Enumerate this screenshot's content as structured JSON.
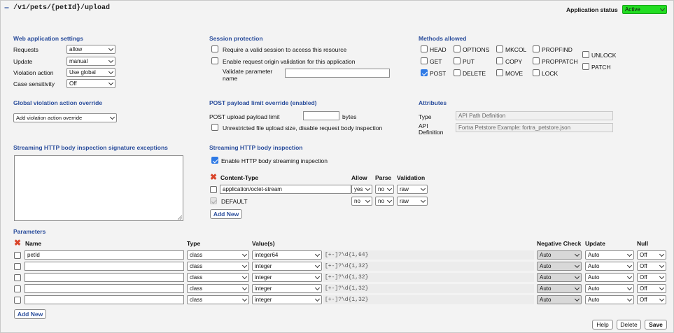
{
  "header": {
    "collapse_glyph": "−",
    "path": "/v1/pets/{petId}/upload",
    "status_label": "Application status",
    "status_value": "Active"
  },
  "web_app": {
    "title": "Web application settings",
    "rows": [
      {
        "label": "Requests",
        "value": "allow"
      },
      {
        "label": "Update",
        "value": "manual"
      },
      {
        "label": "Violation action",
        "value": "Use global"
      },
      {
        "label": "Case sensitivity",
        "value": "Off"
      }
    ]
  },
  "session": {
    "title": "Session protection",
    "opt1": "Require a valid session to access this resource",
    "opt2": "Enable request origin validation for this application",
    "validate_label_1": "Validate parameter",
    "validate_label_2": "name",
    "validate_value": ""
  },
  "methods": {
    "title": "Methods allowed",
    "col1": [
      {
        "label": "HEAD",
        "checked": false
      },
      {
        "label": "GET",
        "checked": false
      },
      {
        "label": "POST",
        "checked": true
      }
    ],
    "col2": [
      {
        "label": "OPTIONS",
        "checked": false
      },
      {
        "label": "PUT",
        "checked": false
      },
      {
        "label": "DELETE",
        "checked": false
      }
    ],
    "col3": [
      {
        "label": "MKCOL",
        "checked": false
      },
      {
        "label": "COPY",
        "checked": false
      },
      {
        "label": "MOVE",
        "checked": false
      }
    ],
    "col4": [
      {
        "label": "PROPFIND",
        "checked": false
      },
      {
        "label": "PROPPATCH",
        "checked": false
      },
      {
        "label": "LOCK",
        "checked": false
      }
    ],
    "col5": [
      {
        "label": "UNLOCK",
        "checked": false
      },
      {
        "label": "PATCH",
        "checked": false
      }
    ]
  },
  "global_violation": {
    "title": "Global violation action override",
    "value": "Add violation action override"
  },
  "post_limit": {
    "title": "POST payload limit override (enabled)",
    "label": "POST upload payload limit",
    "value": "",
    "unit": "bytes",
    "unrestricted": "Unrestricted file upload size, disable request body inspection"
  },
  "attributes": {
    "title": "Attributes",
    "type_label": "Type",
    "type_value": "API Path Definition",
    "api_label_1": "API",
    "api_label_2": "Definition",
    "api_value": "Fortra Petstore Example: fortra_petstore.json"
  },
  "streaming_exceptions": {
    "title": "Streaming HTTP body inspection signature exceptions"
  },
  "streaming": {
    "title": "Streaming HTTP body inspection",
    "enable_label": "Enable HTTP body streaming inspection",
    "headers": {
      "content_type": "Content-Type",
      "allow": "Allow",
      "parse": "Parse",
      "validation": "Validation"
    },
    "rows": [
      {
        "content_type": "application/octet-stream",
        "allow": "yes",
        "parse": "no",
        "validation": "raw"
      },
      {
        "content_type": "DEFAULT",
        "allow": "no",
        "parse": "no",
        "validation": "raw"
      }
    ],
    "add_new": "Add New"
  },
  "parameters": {
    "title": "Parameters",
    "headers": {
      "name": "Name",
      "type": "Type",
      "values": "Value(s)",
      "neg": "Negative Check",
      "update": "Update",
      "null": "Null"
    },
    "rows": [
      {
        "name": "petId",
        "type": "class",
        "value": "integer64",
        "regex": "[+-]?\\d{1,64}",
        "neg": "Auto",
        "update": "Auto",
        "null": "Off"
      },
      {
        "name": "",
        "type": "class",
        "value": "integer",
        "regex": "[+-]?\\d{1,32}",
        "neg": "Auto",
        "update": "Auto",
        "null": "Off"
      },
      {
        "name": "",
        "type": "class",
        "value": "integer",
        "regex": "[+-]?\\d{1,32}",
        "neg": "Auto",
        "update": "Auto",
        "null": "Off"
      },
      {
        "name": "",
        "type": "class",
        "value": "integer",
        "regex": "[+-]?\\d{1,32}",
        "neg": "Auto",
        "update": "Auto",
        "null": "Off"
      },
      {
        "name": "",
        "type": "class",
        "value": "integer",
        "regex": "[+-]?\\d{1,32}",
        "neg": "Auto",
        "update": "Auto",
        "null": "Off"
      }
    ],
    "add_new": "Add New"
  },
  "footer": {
    "help": "Help",
    "delete": "Delete",
    "save": "Save"
  }
}
